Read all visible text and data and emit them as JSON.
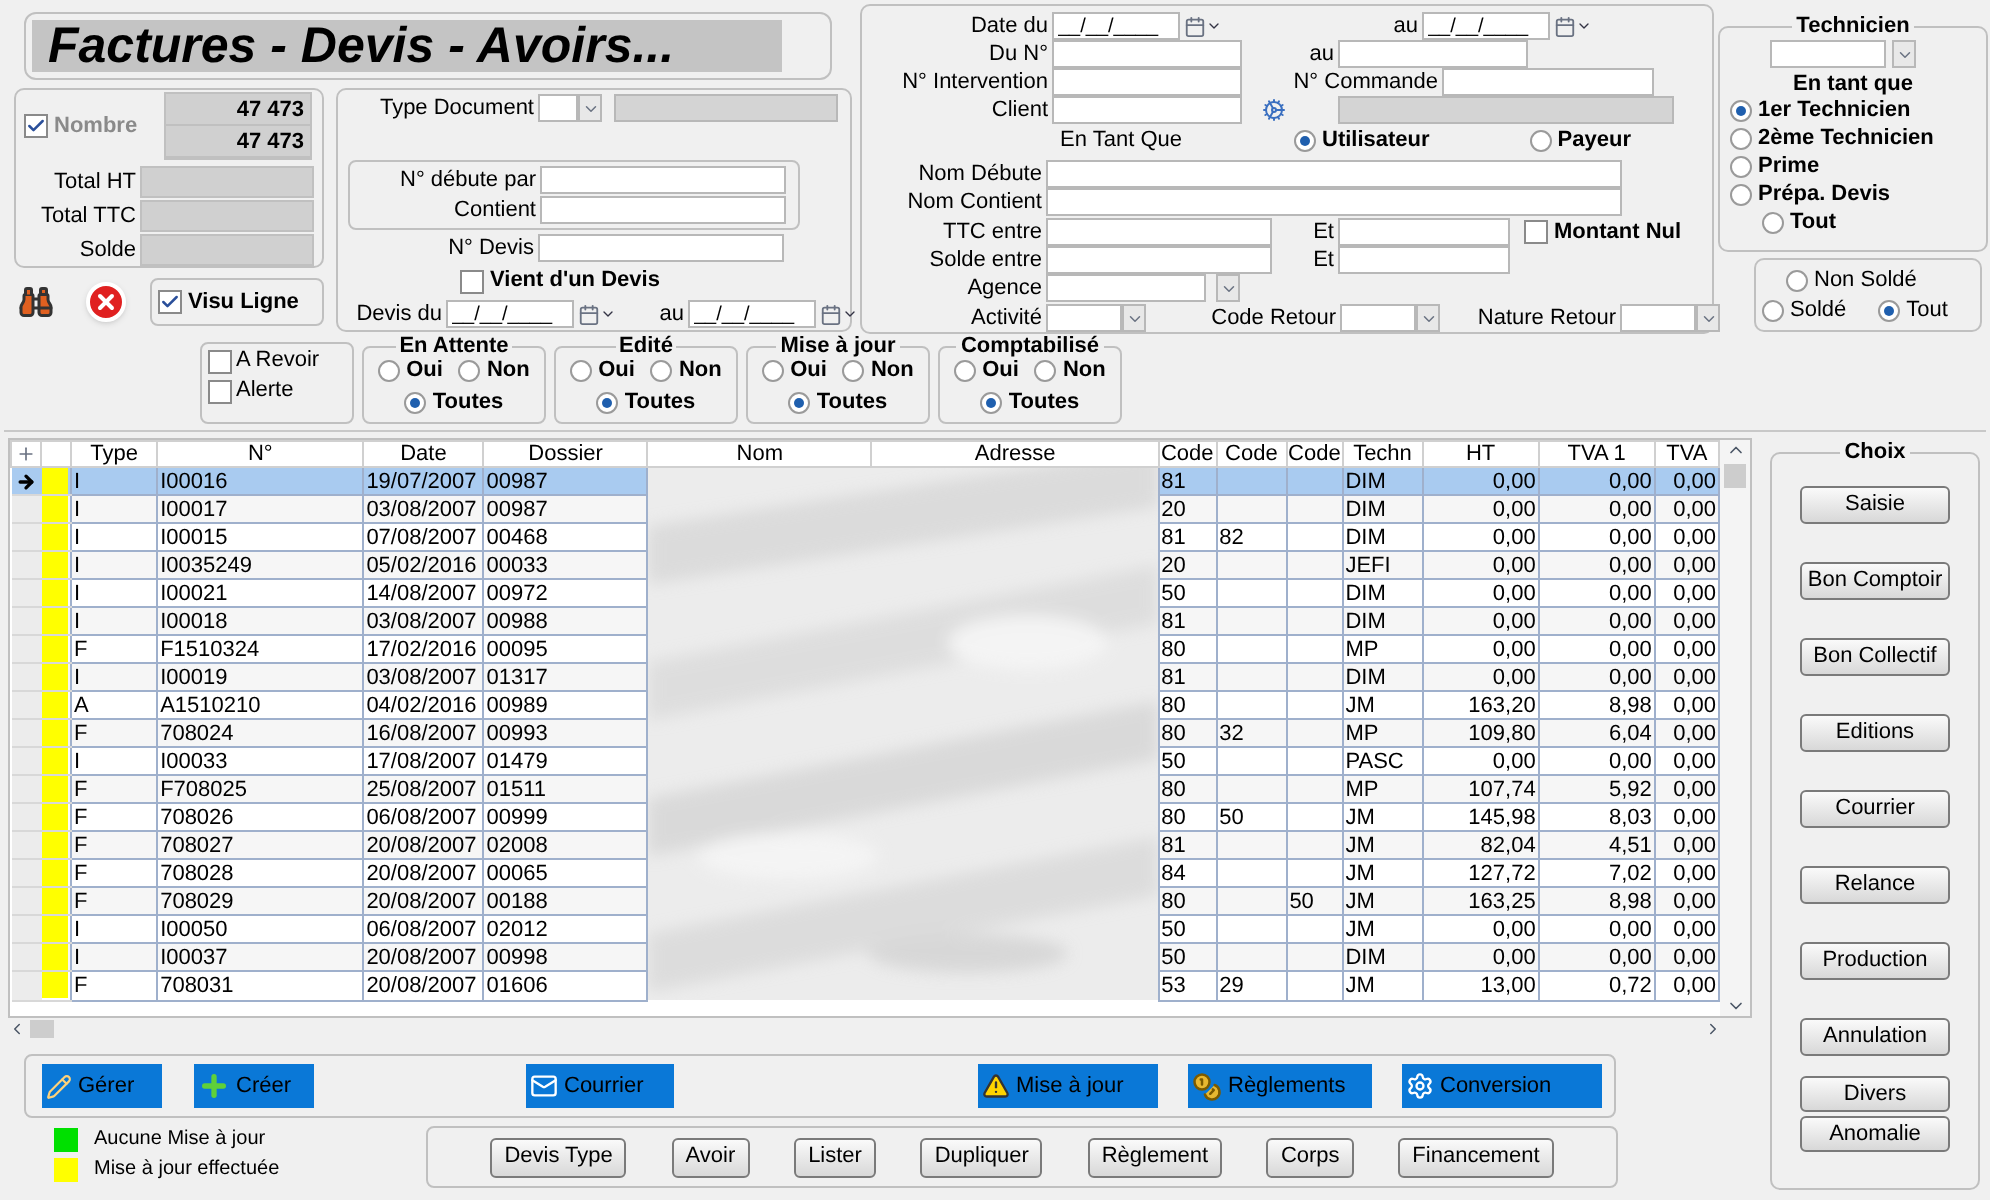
{
  "title": "Factures - Devis - Avoirs...",
  "counter": {
    "label": "Nombre",
    "checked": true,
    "values": [
      "47 473",
      "47 473"
    ]
  },
  "totals": [
    {
      "label": "Total HT"
    },
    {
      "label": "Total TTC"
    },
    {
      "label": "Solde"
    }
  ],
  "visu_ligne": {
    "label": "Visu Ligne",
    "checked": true
  },
  "type_document": {
    "label": "Type Document"
  },
  "numero": [
    {
      "label": "N° débute par"
    },
    {
      "label": "Contient"
    }
  ],
  "devis_no": {
    "label": "N° Devis"
  },
  "vient_devis": {
    "label": "Vient d'un Devis",
    "checked": false
  },
  "devis_dates": {
    "label": "Devis du",
    "from": "__/__/____",
    "to_label": "au",
    "to": "__/__/____"
  },
  "flags": [
    {
      "label": "A Revoir",
      "checked": false
    },
    {
      "label": "Alerte",
      "checked": false
    }
  ],
  "radio_groups": [
    {
      "title": "En Attente",
      "options": [
        {
          "label": "Oui",
          "selected": false
        },
        {
          "label": "Non",
          "selected": false
        },
        {
          "label": "Toutes",
          "selected": true
        }
      ]
    },
    {
      "title": "Edité",
      "options": [
        {
          "label": "Oui",
          "selected": false
        },
        {
          "label": "Non",
          "selected": false
        },
        {
          "label": "Toutes",
          "selected": true
        }
      ]
    },
    {
      "title": "Mise à jour",
      "options": [
        {
          "label": "Oui",
          "selected": false
        },
        {
          "label": "Non",
          "selected": false
        },
        {
          "label": "Toutes",
          "selected": true
        }
      ]
    },
    {
      "title": "Comptabilisé",
      "options": [
        {
          "label": "Oui",
          "selected": false
        },
        {
          "label": "Non",
          "selected": false
        },
        {
          "label": "Toutes",
          "selected": true
        }
      ]
    }
  ],
  "search": {
    "date": {
      "label": "Date du",
      "from": "__/__/____",
      "to_label": "au",
      "to": "__/__/____"
    },
    "du_no": {
      "label": "Du N°",
      "to_label": "au"
    },
    "intervention": {
      "label": "N° Intervention"
    },
    "commande": {
      "label": "N° Commande"
    },
    "client": {
      "label": "Client"
    },
    "en_tant_que": {
      "label": "En Tant Que",
      "options": [
        {
          "label": "Utilisateur",
          "selected": true
        },
        {
          "label": "Payeur",
          "selected": false
        }
      ]
    },
    "nom_debute": {
      "label": "Nom Débute"
    },
    "nom_contient": {
      "label": "Nom Contient"
    },
    "ttc": {
      "label": "TTC  entre",
      "and": "Et"
    },
    "solde": {
      "label": "Solde entre",
      "and": "Et"
    },
    "montant_nul": {
      "label": "Montant Nul",
      "checked": false
    },
    "agence": {
      "label": "Agence"
    },
    "activite": {
      "label": "Activité"
    },
    "code_retour": {
      "label": "Code Retour"
    },
    "nature_retour": {
      "label": "Nature Retour"
    }
  },
  "technicien": {
    "title": "Technicien",
    "subtitle": "En tant que",
    "options": [
      {
        "label": "1er Technicien",
        "selected": true
      },
      {
        "label": "2ème Technicien",
        "selected": false
      },
      {
        "label": "Prime",
        "selected": false
      },
      {
        "label": "Prépa. Devis",
        "selected": false
      },
      {
        "label": "Tout",
        "selected": false
      }
    ]
  },
  "solde_filter": {
    "options": [
      {
        "label": "Non Soldé",
        "selected": false
      },
      {
        "label": "Soldé",
        "selected": false
      },
      {
        "label": "Tout",
        "selected": true
      }
    ]
  },
  "table": {
    "columns": [
      "Type",
      "N°",
      "Date",
      "Dossier",
      "Nom",
      "Adresse",
      "Code",
      "Code",
      "Code",
      "Techn",
      "HT",
      "TVA 1",
      "TVA"
    ],
    "rows": [
      {
        "selected": true,
        "color": "#ffff00",
        "type": "I",
        "no": "I00016",
        "date": "19/07/2007",
        "dossier": "00987",
        "code1": "81",
        "techn": "DIM",
        "ht": "0,00",
        "tva1": "0,00",
        "tva2": "0,00"
      },
      {
        "selected": false,
        "color": "#ffff00",
        "type": "I",
        "no": "I00017",
        "date": "03/08/2007",
        "dossier": "00987",
        "code1": "20",
        "techn": "DIM",
        "ht": "0,00",
        "tva1": "0,00",
        "tva2": "0,00"
      },
      {
        "selected": false,
        "color": "#ffff00",
        "type": "I",
        "no": "I00015",
        "date": "07/08/2007",
        "dossier": "00468",
        "code1": "81",
        "code2": "82",
        "techn": "DIM",
        "ht": "0,00",
        "tva1": "0,00",
        "tva2": "0,00"
      },
      {
        "selected": false,
        "color": "#ffff00",
        "type": "I",
        "no": "I0035249",
        "date": "05/02/2016",
        "dossier": "00033",
        "code1": "20",
        "techn": "JEFI",
        "ht": "0,00",
        "tva1": "0,00",
        "tva2": "0,00"
      },
      {
        "selected": false,
        "color": "#ffff00",
        "type": "I",
        "no": "I00021",
        "date": "14/08/2007",
        "dossier": "00972",
        "code1": "50",
        "techn": "DIM",
        "ht": "0,00",
        "tva1": "0,00",
        "tva2": "0,00"
      },
      {
        "selected": false,
        "color": "#ffff00",
        "type": "I",
        "no": "I00018",
        "date": "03/08/2007",
        "dossier": "00988",
        "code1": "81",
        "techn": "DIM",
        "ht": "0,00",
        "tva1": "0,00",
        "tva2": "0,00"
      },
      {
        "selected": false,
        "color": "#ffff00",
        "type": "F",
        "no": "F1510324",
        "date": "17/02/2016",
        "dossier": "00095",
        "code1": "80",
        "techn": "MP",
        "ht": "0,00",
        "tva1": "0,00",
        "tva2": "0,00"
      },
      {
        "selected": false,
        "color": "#ffff00",
        "type": "I",
        "no": "I00019",
        "date": "03/08/2007",
        "dossier": "01317",
        "code1": "81",
        "techn": "DIM",
        "ht": "0,00",
        "tva1": "0,00",
        "tva2": "0,00"
      },
      {
        "selected": false,
        "color": "#ffff00",
        "type": "A",
        "no": "A1510210",
        "date": "04/02/2016",
        "dossier": "00989",
        "code1": "80",
        "techn": "JM",
        "ht": "163,20",
        "tva1": "8,98",
        "tva2": "0,00"
      },
      {
        "selected": false,
        "color": "#ffff00",
        "type": "F",
        "no": "708024",
        "date": "16/08/2007",
        "dossier": "00993",
        "code1": "80",
        "code2": "32",
        "techn": "MP",
        "ht": "109,80",
        "tva1": "6,04",
        "tva2": "0,00"
      },
      {
        "selected": false,
        "color": "#ffff00",
        "type": "I",
        "no": "I00033",
        "date": "17/08/2007",
        "dossier": "01479",
        "code1": "50",
        "techn": "PASC",
        "ht": "0,00",
        "tva1": "0,00",
        "tva2": "0,00"
      },
      {
        "selected": false,
        "color": "#ffff00",
        "type": "F",
        "no": "F708025",
        "date": "25/08/2007",
        "dossier": "01511",
        "code1": "80",
        "techn": "MP",
        "ht": "107,74",
        "tva1": "5,92",
        "tva2": "0,00"
      },
      {
        "selected": false,
        "color": "#ffff00",
        "type": "F",
        "no": "708026",
        "date": "06/08/2007",
        "dossier": "00999",
        "code1": "80",
        "code2": "50",
        "techn": "JM",
        "ht": "145,98",
        "tva1": "8,03",
        "tva2": "0,00"
      },
      {
        "selected": false,
        "color": "#ffff00",
        "type": "F",
        "no": "708027",
        "date": "20/08/2007",
        "dossier": "02008",
        "code1": "81",
        "techn": "JM",
        "ht": "82,04",
        "tva1": "4,51",
        "tva2": "0,00"
      },
      {
        "selected": false,
        "color": "#ffff00",
        "type": "F",
        "no": "708028",
        "date": "20/08/2007",
        "dossier": "00065",
        "code1": "84",
        "techn": "JM",
        "ht": "127,72",
        "tva1": "7,02",
        "tva2": "0,00"
      },
      {
        "selected": false,
        "color": "#ffff00",
        "type": "F",
        "no": "708029",
        "date": "20/08/2007",
        "dossier": "00188",
        "code1": "80",
        "code3": "50",
        "techn": "JM",
        "ht": "163,25",
        "tva1": "8,98",
        "tva2": "0,00"
      },
      {
        "selected": false,
        "color": "#ffff00",
        "type": "I",
        "no": "I00050",
        "date": "06/08/2007",
        "dossier": "02012",
        "code1": "50",
        "techn": "JM",
        "ht": "0,00",
        "tva1": "0,00",
        "tva2": "0,00"
      },
      {
        "selected": false,
        "color": "#ffff00",
        "type": "I",
        "no": "I00037",
        "date": "20/08/2007",
        "dossier": "00998",
        "code1": "50",
        "techn": "DIM",
        "ht": "0,00",
        "tva1": "0,00",
        "tva2": "0,00"
      },
      {
        "selected": false,
        "color": "#ffff00",
        "type": "F",
        "no": "708031",
        "date": "20/08/2007",
        "dossier": "01606",
        "code1": "53",
        "code2": "29",
        "techn": "JM",
        "ht": "13,00",
        "tva1": "0,72",
        "tva2": "0,00"
      }
    ]
  },
  "toolbar": [
    {
      "label": "Gérer"
    },
    {
      "label": "Créer"
    },
    {
      "label": "Courrier"
    },
    {
      "label": "Mise à jour"
    },
    {
      "label": "Règlements"
    },
    {
      "label": "Conversion"
    }
  ],
  "legend": [
    {
      "label": "Aucune Mise à jour",
      "color": "#00e000"
    },
    {
      "label": "Mise à jour effectuée",
      "color": "#ffff00"
    }
  ],
  "actions": [
    "Devis Type",
    "Avoir",
    "Lister",
    "Dupliquer",
    "Règlement",
    "Corps",
    "Financement"
  ],
  "choix": {
    "title": "Choix",
    "buttons": [
      "Saisie",
      "Bon Comptoir",
      "Bon Collectif",
      "Editions",
      "Courrier",
      "Relance",
      "Production",
      "Annulation"
    ],
    "extra": [
      "Divers",
      "Anomalie"
    ]
  }
}
